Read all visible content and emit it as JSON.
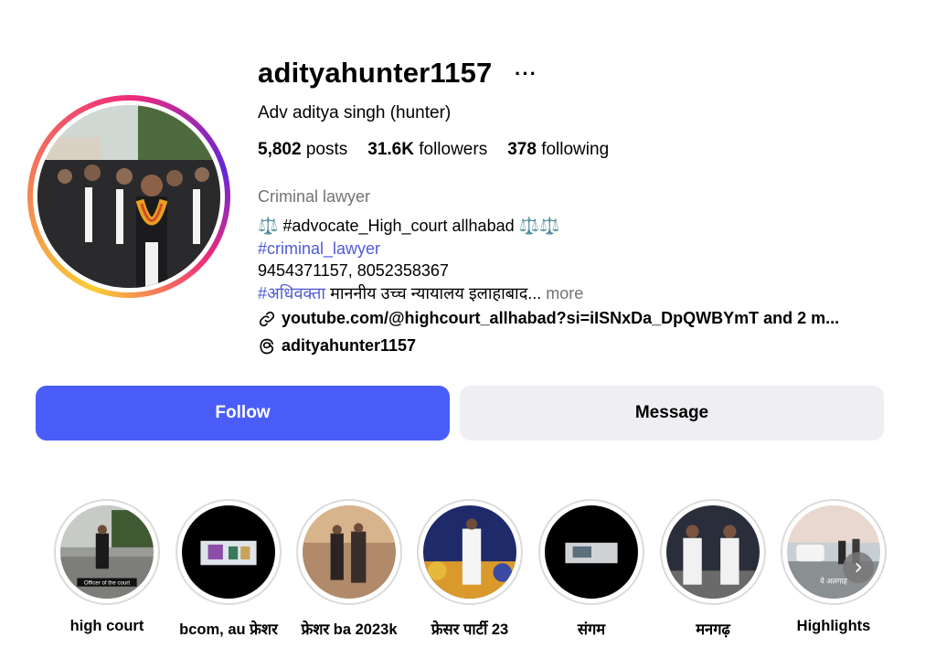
{
  "profile": {
    "username": "adityahunter1157",
    "more_label": "···",
    "full_name": "Adv aditya singh (hunter)",
    "posts_count": "5,802",
    "posts_label": "posts",
    "followers_count": "31.6K",
    "followers_label": "followers",
    "following_count": "378",
    "following_label": "following",
    "category": "Criminal lawyer",
    "bio_line1": "⚖️ #advocate_High_court allhabad ⚖️⚖️",
    "bio_hashtag": "#criminal_lawyer",
    "bio_phones": "9454371157, 8052358367",
    "bio_hashtag2": "#अधिवक्ता",
    "bio_line4_rest": " माननीय उच्च न्यायालय इलाहाबाद...",
    "more_text": "more",
    "link_text": "youtube.com/@highcourt_allhabad?si=iISNxDa_DpQWBYmT and 2 m...",
    "threads_handle": "adityahunter1157"
  },
  "actions": {
    "follow_label": "Follow",
    "message_label": "Message"
  },
  "highlights": [
    {
      "label": "high court",
      "caption": "Officer of the court"
    },
    {
      "label": "bcom, au फ्रेशर"
    },
    {
      "label": "फ्रेशर ba 2023k"
    },
    {
      "label": "फ्रेसर पार्टी 23"
    },
    {
      "label": "संगम"
    },
    {
      "label": "मनगढ़"
    },
    {
      "label": "Highlights",
      "caption": "ये अलगाह"
    }
  ],
  "colors": {
    "follow_button": "#4a5df9",
    "message_button": "#efeff3",
    "hashtag": "#4f5bd5",
    "secondary_text": "#737373"
  },
  "icons": {
    "link": "link-icon",
    "threads": "threads-icon",
    "next": "chevron-right-icon"
  }
}
